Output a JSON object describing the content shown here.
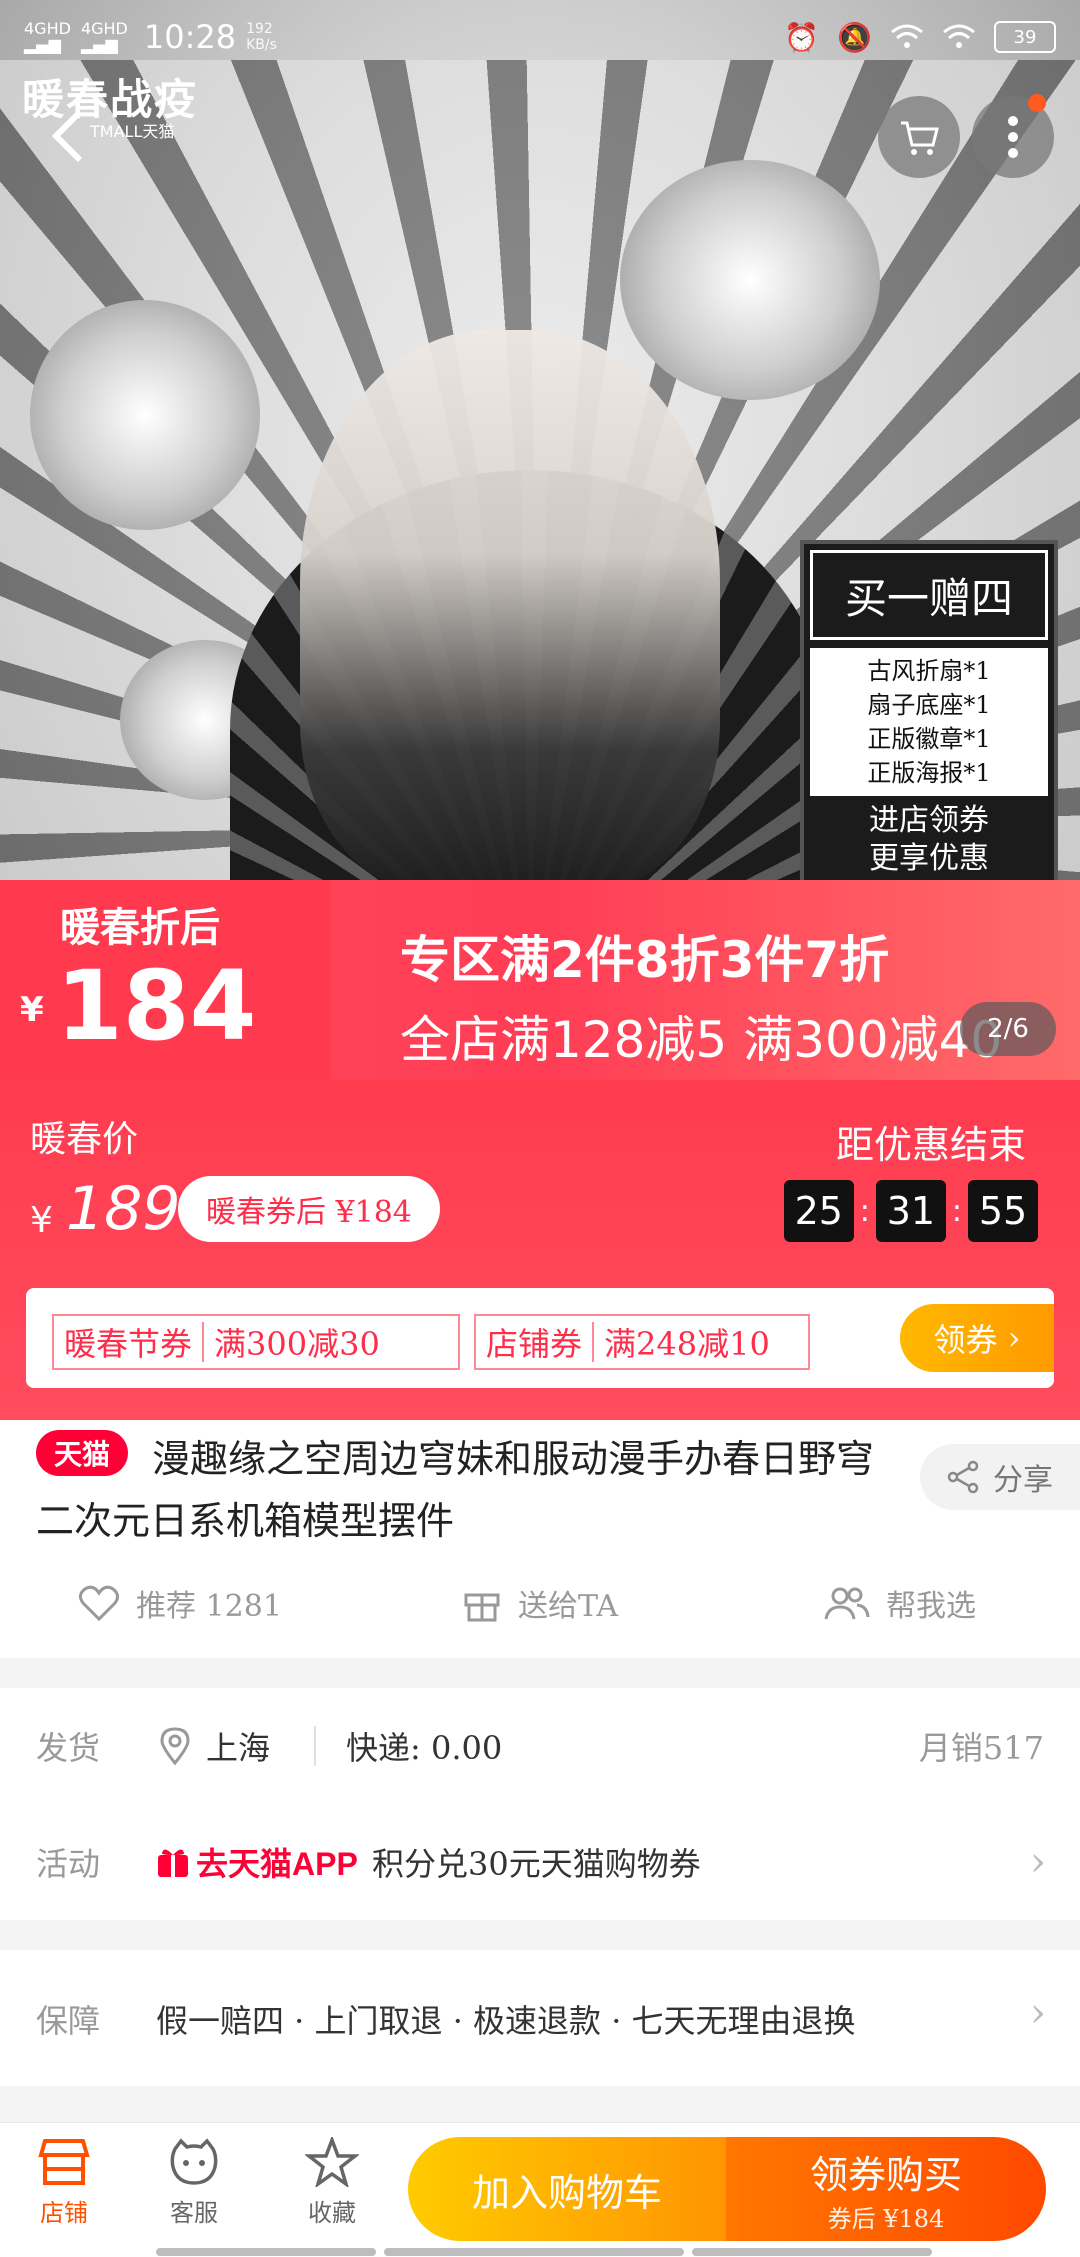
{
  "status": {
    "net1": "4GHD",
    "net2": "4GHD",
    "time": "10:28",
    "speed_value": "192",
    "speed_unit": "KB/s",
    "battery": "39"
  },
  "hero": {
    "brand_title": "暖春战疫",
    "brand_sub": "TMALL天猫",
    "promo_head": "买一赠四",
    "promo_items": [
      "古风折扇*1",
      "扇子底座*1",
      "正版徽章*1",
      "正版海报*1"
    ],
    "promo_foot1": "进店领券",
    "promo_foot2": "更享优惠",
    "band_label": "暖春折后",
    "band_yuan": "¥",
    "band_price": "184",
    "band_line1": "专区满2件8折3件7折",
    "band_line2": "全店满128减5 满300减40",
    "pager": "2/6"
  },
  "price": {
    "label": "暖春价",
    "yuan": "¥",
    "value": "189",
    "after_coupon": "暖春券后 ¥184",
    "countdown_label": "距优惠结束",
    "countdown": [
      "25",
      "31",
      "55"
    ]
  },
  "coupons": [
    {
      "type": "暖春节券",
      "value": "满300减30"
    },
    {
      "type": "店铺券",
      "value": "满248减10"
    }
  ],
  "coupon_button": "领券",
  "product": {
    "badge": "天猫",
    "title": "漫趣缘之空周边穹妹和服动漫手办春日野穹二次元日系机箱模型摆件",
    "share": "分享",
    "actions": [
      "推荐 1281",
      "送给TA",
      "帮我选"
    ]
  },
  "shipping": {
    "label": "发货",
    "location": "上海",
    "express": "快递: 0.00",
    "monthly": "月销517"
  },
  "activity": {
    "label": "活动",
    "badge": "去天猫APP",
    "text": "积分兑30元天猫购物券"
  },
  "guarantee": {
    "label": "保障",
    "text": "假一赔四 · 上门取退 · 极速退款 · 七天无理由退换"
  },
  "bottom": {
    "tabs": [
      "店铺",
      "客服",
      "收藏"
    ],
    "add_cart": "加入购物车",
    "buy": "领券购买",
    "buy_sub": "券后 ¥184"
  },
  "colors": {
    "accent": "#ff0036",
    "price_band": "#ff3b4f",
    "cart_button": "#ffb800",
    "buy_button": "#ff5000"
  }
}
